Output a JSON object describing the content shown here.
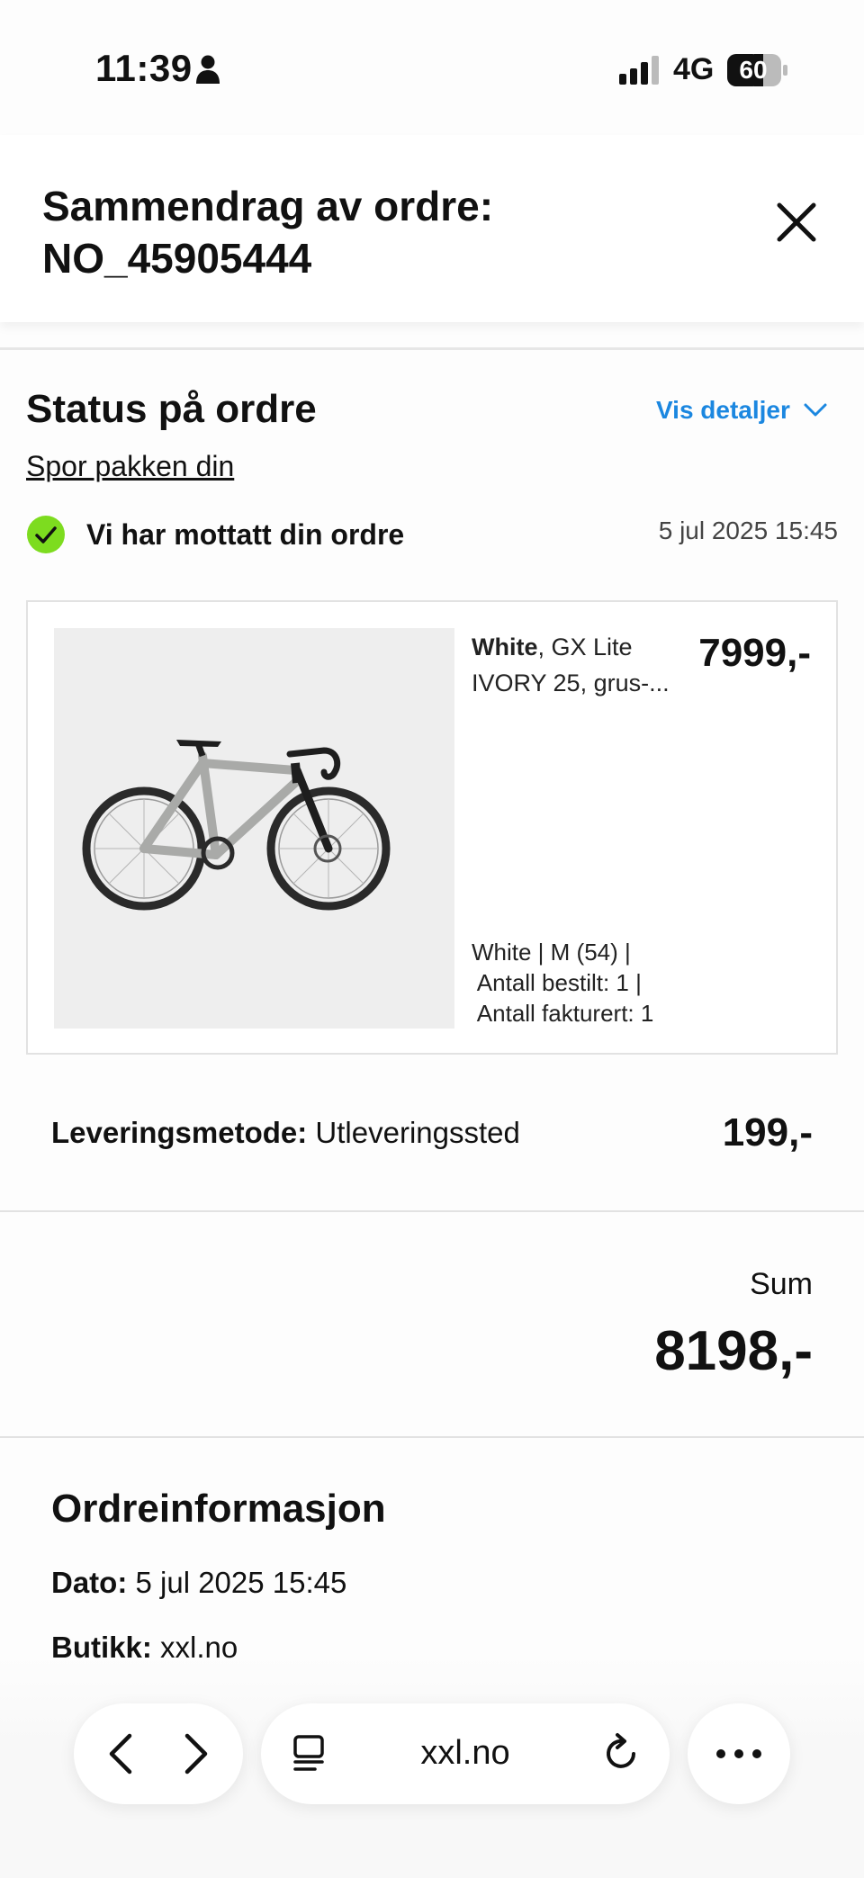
{
  "status_bar": {
    "time": "11:39",
    "network": "4G",
    "battery": "60"
  },
  "header": {
    "title_line1": "Sammendrag av ordre:",
    "title_line2": "NO_45905444"
  },
  "status": {
    "title": "Status på ordre",
    "details_label": "Vis detaljer",
    "track_label": "Spor pakken din",
    "received_text": "Vi har mottatt din ordre",
    "received_date": "5 jul 2025 15:45"
  },
  "product": {
    "name_bold": "White",
    "name_rest": ", GX Lite IVORY 25, grus-...",
    "price": "7999,-",
    "meta_line1": "White | M (54) |",
    "meta_line2": " Antall bestilt: 1 |",
    "meta_line3": " Antall fakturert: 1"
  },
  "delivery": {
    "label": "Leveringsmetode:",
    "value": " Utleveringssted",
    "price": "199,-"
  },
  "sum": {
    "label": "Sum",
    "value": "8198,-"
  },
  "order_info": {
    "title": "Ordreinformasjon",
    "date_label": "Dato:",
    "date_value": " 5 jul 2025 15:45",
    "store_label": "Butikk:",
    "store_value": " xxl.no"
  },
  "browser": {
    "url": "xxl.no"
  },
  "colors": {
    "accent": "#1b87e0",
    "check": "#7ddc1f"
  }
}
